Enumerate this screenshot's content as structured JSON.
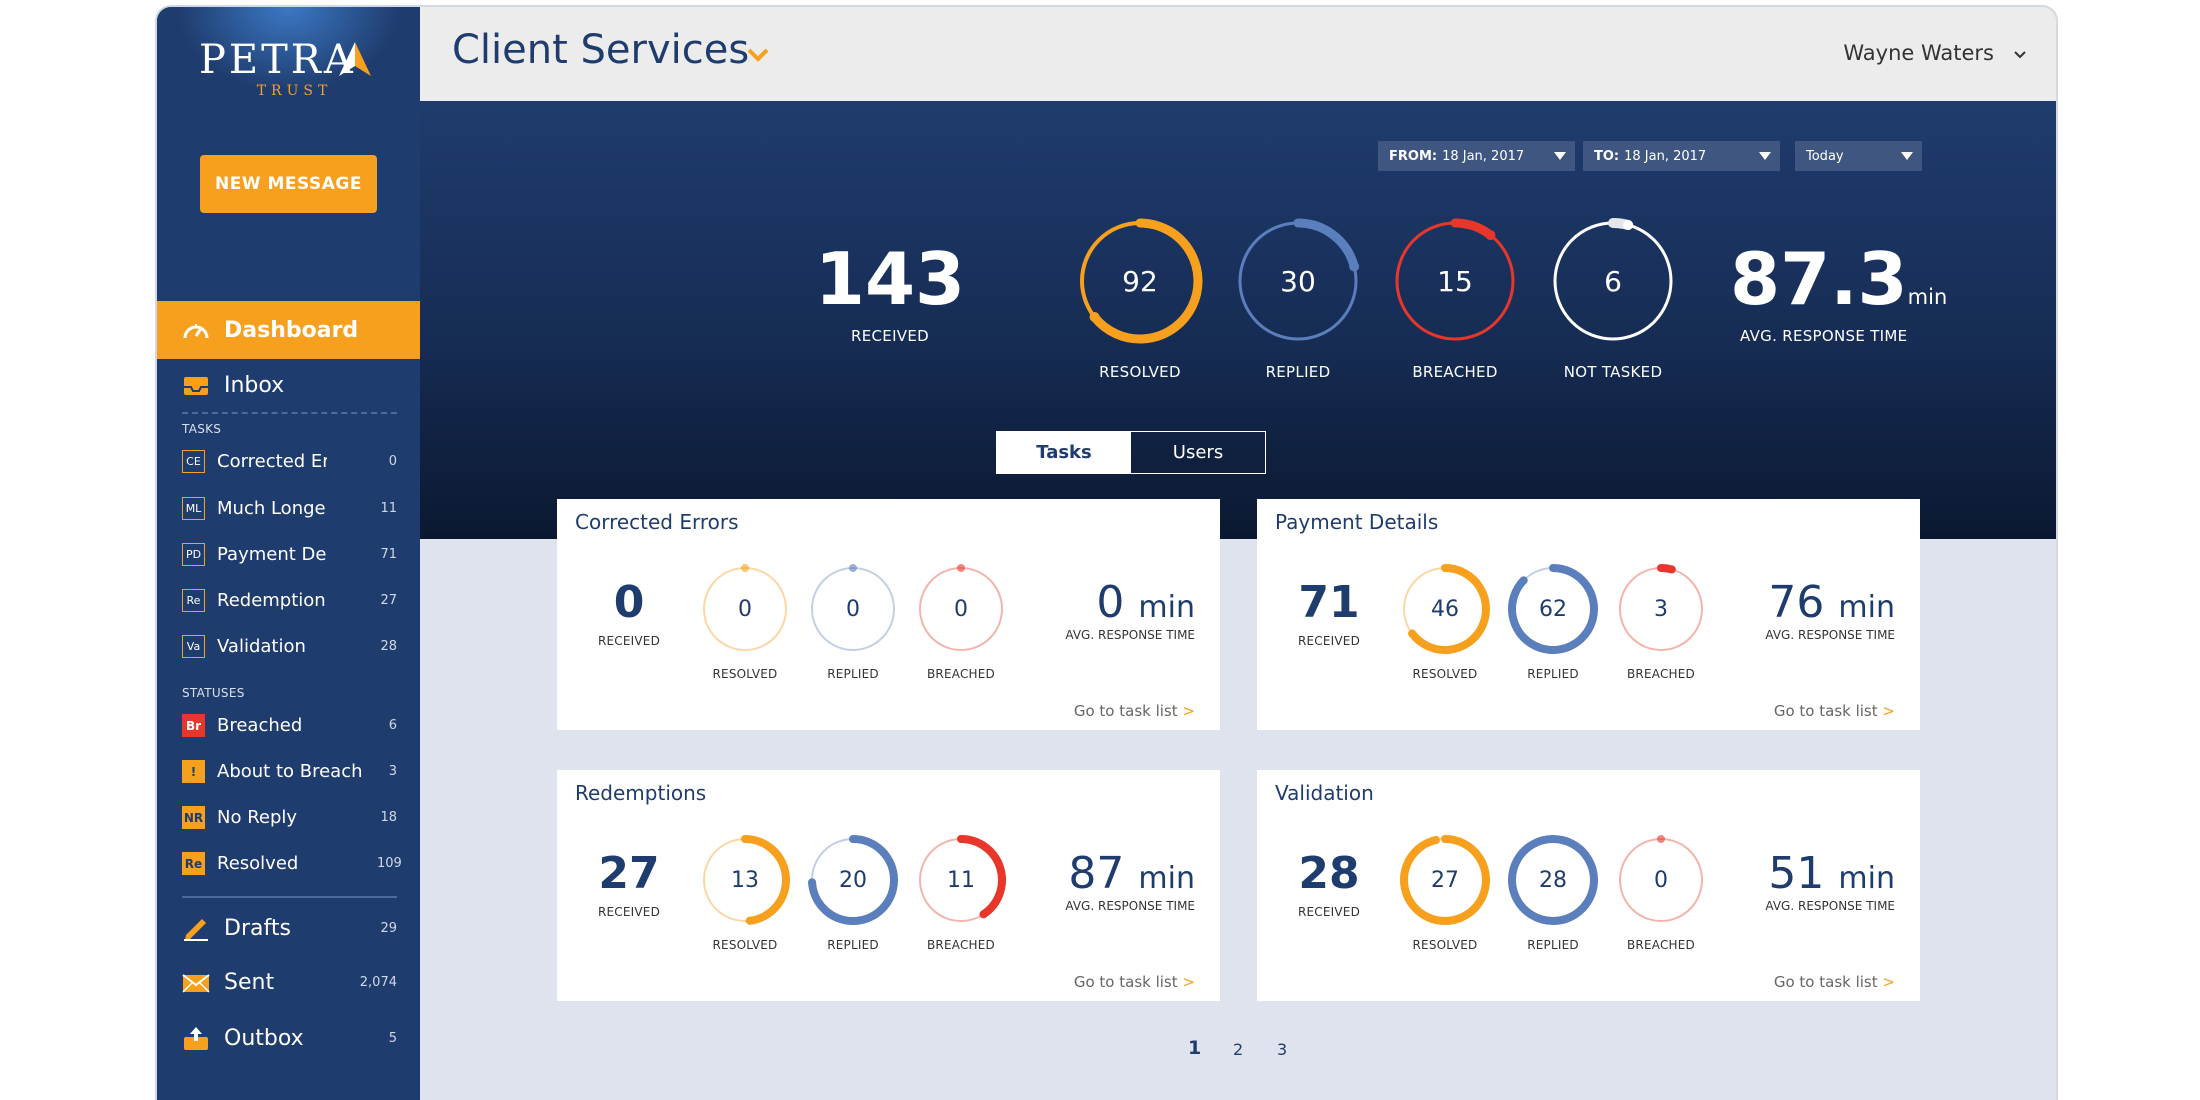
{
  "logo": {
    "word": "PETRA",
    "sub": "TRUST"
  },
  "new_message_label": "NEW MESSAGE",
  "nav": {
    "dashboard": "Dashboard",
    "inbox": "Inbox",
    "tasks_heading": "TASKS",
    "tasks": [
      {
        "badge": "CE",
        "name": "Corrected Errors",
        "count": "0"
      },
      {
        "badge": "ML",
        "name": "Much Longer",
        "count": "11"
      },
      {
        "badge": "PD",
        "name": "Payment Details",
        "count": "71"
      },
      {
        "badge": "Re",
        "name": "Redemption",
        "count": "27"
      },
      {
        "badge": "Va",
        "name": "Validation",
        "count": "28"
      }
    ],
    "statuses_heading": "STATUSES",
    "statuses": [
      {
        "badge": "Br",
        "name": "Breached",
        "count": "6"
      },
      {
        "badge": "!",
        "name": "About to Breach",
        "count": "3"
      },
      {
        "badge": "NR",
        "name": "No Reply",
        "count": "18"
      },
      {
        "badge": "Re",
        "name": "Resolved",
        "count": "109"
      }
    ],
    "drafts": {
      "label": "Drafts",
      "count": "29"
    },
    "sent": {
      "label": "Sent",
      "count": "2,074"
    },
    "outbox": {
      "label": "Outbox",
      "count": "5"
    }
  },
  "header": {
    "title": "Client Services",
    "user": "Wayne Waters"
  },
  "filters": {
    "from_label": "FROM:",
    "from_value": "18 Jan, 2017",
    "to_label": "TO:",
    "to_value": "18 Jan, 2017",
    "range": "Today"
  },
  "summary": {
    "received": {
      "value": "143",
      "label": "RECEIVED"
    },
    "resolved": {
      "value": "92",
      "label": "RESOLVED"
    },
    "replied": {
      "value": "30",
      "label": "REPLIED"
    },
    "breached": {
      "value": "15",
      "label": "BREACHED"
    },
    "not_tasked": {
      "value": "6",
      "label": "NOT TASKED"
    },
    "avg": {
      "value": "87.3",
      "unit": "min",
      "label": "AVG. RESPONSE TIME"
    }
  },
  "tabs": {
    "tasks": "Tasks",
    "users": "Users"
  },
  "labels": {
    "received": "RECEIVED",
    "resolved": "RESOLVED",
    "replied": "REPLIED",
    "breached": "BREACHED",
    "avg": "AVG. RESPONSE TIME",
    "go": "Go to task list",
    "go_arrow": ">"
  },
  "cards": [
    {
      "title": "Corrected Errors",
      "received": "0",
      "resolved": "0",
      "replied": "0",
      "breached": "0",
      "avg": "0",
      "unit": "min"
    },
    {
      "title": "Payment Details",
      "received": "71",
      "resolved": "46",
      "replied": "62",
      "breached": "3",
      "avg": "76",
      "unit": "min"
    },
    {
      "title": "Redemptions",
      "received": "27",
      "resolved": "13",
      "replied": "20",
      "breached": "11",
      "avg": "87",
      "unit": "min"
    },
    {
      "title": "Validation",
      "received": "28",
      "resolved": "27",
      "replied": "28",
      "breached": "0",
      "avg": "51",
      "unit": "min"
    }
  ],
  "pager": [
    "1",
    "2",
    "3"
  ],
  "colors": {
    "sidebar": "#1f3c6e",
    "accent": "#f7a01e",
    "resolved": "#f7a01e",
    "replied": "#5b7fbd",
    "breached": "#e8372a",
    "not_tasked": "#ffffff"
  }
}
